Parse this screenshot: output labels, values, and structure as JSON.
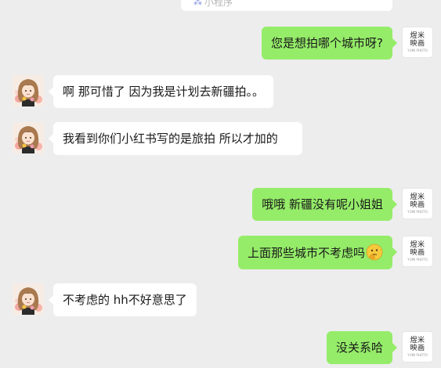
{
  "top_card": {
    "icon": "mini-program-icon",
    "label": "小程序"
  },
  "brand_avatar": {
    "line1": "煜米",
    "line2": "映画",
    "small": "YUMI PHOTO"
  },
  "messages": [
    {
      "side": "right",
      "text": "您是想拍哪个城市呀?"
    },
    {
      "side": "left",
      "text": "啊 那可惜了 因为我是计划去新疆拍。。"
    },
    {
      "side": "left",
      "text": "我看到你们小红书写的是旅拍 所以才加的"
    },
    {
      "side": "right",
      "text": "哦哦 新疆没有呢小姐姐"
    },
    {
      "side": "right",
      "text": "上面那些城市不考虑吗",
      "emoji": "thinking-emoji"
    },
    {
      "side": "left",
      "text": "不考虑的 hh不好意思了"
    },
    {
      "side": "right",
      "text": "没关系哈"
    }
  ],
  "colors": {
    "background": "#ededed",
    "bubble_self": "#95ec69",
    "bubble_other": "#ffffff"
  }
}
